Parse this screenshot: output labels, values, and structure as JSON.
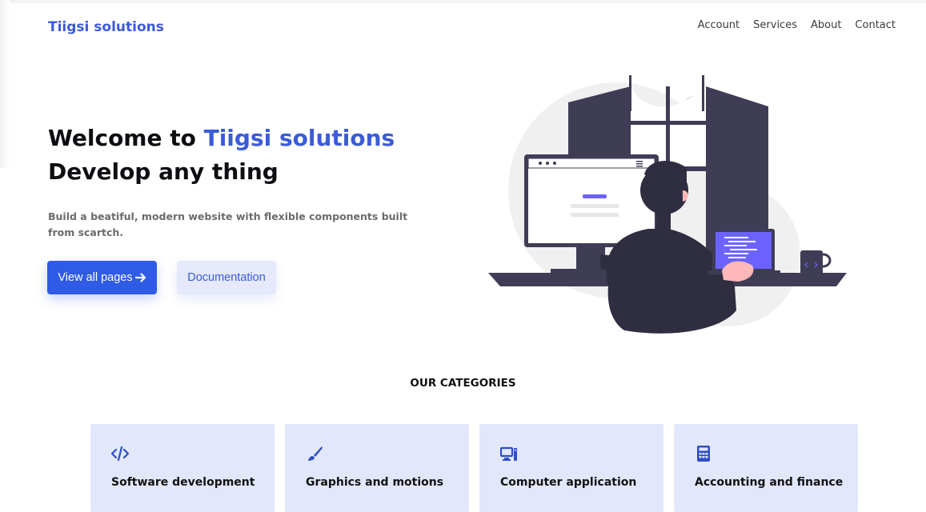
{
  "header": {
    "brand": "Tiigsi solutions",
    "nav": [
      "Account",
      "Services",
      "About",
      "Contact"
    ]
  },
  "hero": {
    "title_prefix": "Welcome to ",
    "title_accent": "Tiigsi solutions",
    "title_line2": "Develop any thing",
    "subtitle": "Build a beatiful, modern website with flexible components built from scartch.",
    "primary_button": "View all pages",
    "primary_button_icon": "arrow-right-icon",
    "secondary_button": "Documentation"
  },
  "categories": {
    "heading": "OUR CATEGORIES",
    "items": [
      {
        "label": "Software development",
        "icon": "code-icon"
      },
      {
        "label": "Graphics and motions",
        "icon": "paintbrush-icon"
      },
      {
        "label": "Computer application",
        "icon": "desktop-computer-icon"
      },
      {
        "label": "Accounting and finance",
        "icon": "calculator-icon"
      }
    ]
  },
  "colors": {
    "accent": "#3b5bd8",
    "primary_button": "#2f5be6",
    "card_background": "#e2e7fc",
    "illustration_dark": "#3f3d56",
    "illustration_accent": "#6c63ff"
  }
}
